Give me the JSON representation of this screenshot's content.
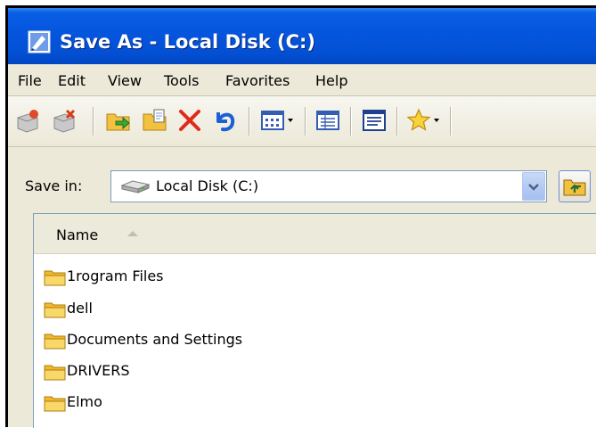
{
  "window": {
    "title": "Save As - Local Disk (C:)",
    "icon": "save-as-icon"
  },
  "menu": [
    "File",
    "Edit",
    "View",
    "Tools",
    "Favorites",
    "Help"
  ],
  "toolbar": {
    "buttons": [
      "add-icon",
      "remove-icon",
      "move-to-icon",
      "copy-to-icon",
      "delete-icon",
      "undo-icon",
      "views-icon",
      "details-icon",
      "properties-icon",
      "favorites-icon"
    ]
  },
  "save_in": {
    "label": "Save in:",
    "value": "Local Disk (C:)",
    "drive_icon": "hard-disk-icon"
  },
  "file_list": {
    "column_header": "Name",
    "sort": "ascending",
    "items": [
      {
        "name": "1rogram Files",
        "icon": "folder-icon"
      },
      {
        "name": "dell",
        "icon": "folder-icon"
      },
      {
        "name": "Documents and Settings",
        "icon": "folder-icon"
      },
      {
        "name": "DRIVERS",
        "icon": "folder-icon"
      },
      {
        "name": "Elmo",
        "icon": "folder-icon"
      }
    ]
  },
  "colors": {
    "titlebar": "#0556df",
    "chrome": "#ece9d8",
    "list_bg": "#ffffff",
    "folder": "#f5c94a"
  }
}
